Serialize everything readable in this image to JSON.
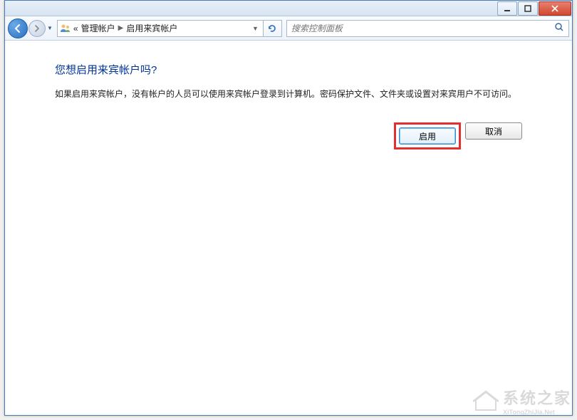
{
  "breadcrumb": {
    "prefix": "«",
    "item1": "管理帐户",
    "item2": "启用来宾帐户"
  },
  "search": {
    "placeholder": "搜索控制面板"
  },
  "main": {
    "heading": "您想启用来宾帐户吗?",
    "description": "如果启用来宾帐户，没有帐户的人员可以使用来宾帐户登录到计算机。密码保护文件、文件夹或设置对来宾用户不可访问。"
  },
  "buttons": {
    "enable": "启用",
    "cancel": "取消"
  },
  "watermark": {
    "text": "系统之家",
    "sub": "XiTongZhiJia.Net"
  }
}
